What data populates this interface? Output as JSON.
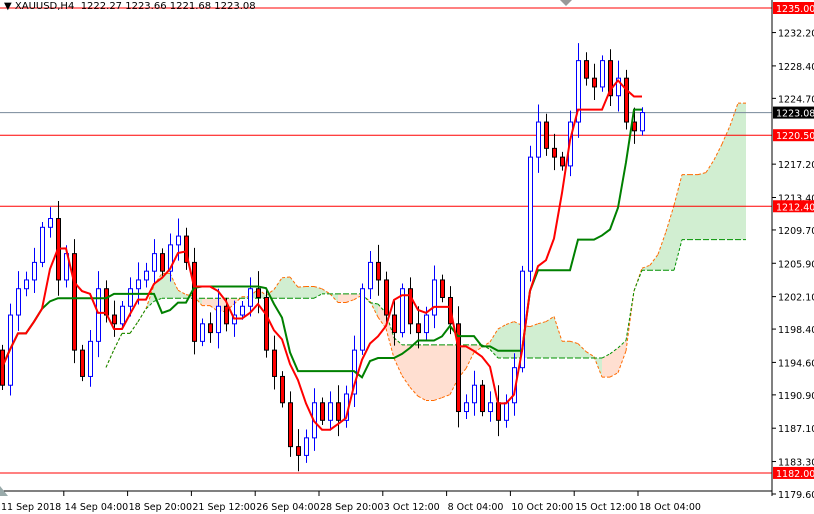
{
  "header": {
    "symbol": "XAUUSD,H4",
    "ohlc": "1222.27 1223.66 1221.68 1223.08"
  },
  "chart_data": {
    "type": "candlestick",
    "title": "XAUUSD,H4",
    "ylim": [
      1179.6,
      1235.0
    ],
    "y_ticks": [
      "1232.20",
      "1228.40",
      "1224.70",
      "1217.20",
      "1213.40",
      "1209.70",
      "1205.90",
      "1202.10",
      "1198.40",
      "1194.60",
      "1190.90",
      "1187.10",
      "1183.30",
      "1179.60"
    ],
    "x_ticks": [
      "11 Sep 2018",
      "14 Sep 04:00",
      "18 Sep 20:00",
      "21 Sep 12:00",
      "26 Sep 04:00",
      "28 Sep 20:00",
      "3 Oct 12:00",
      "8 Oct 04:00",
      "10 Oct 20:00",
      "15 Oct 12:00",
      "18 Oct 04:00"
    ],
    "closes": [
      1192,
      1200,
      1203,
      1204,
      1206,
      1210,
      1211,
      1204,
      1207,
      1196,
      1193,
      1197,
      1203,
      1200,
      1199,
      1201,
      1203,
      1204,
      1205,
      1207,
      1205,
      1208,
      1209,
      1206,
      1197,
      1199,
      1198,
      1201,
      1199,
      1200,
      1201,
      1203,
      1202,
      1196,
      1193,
      1190,
      1185,
      1184,
      1186,
      1190,
      1188,
      1190,
      1188,
      1191,
      1196,
      1203,
      1206,
      1204,
      1200,
      1198,
      1203,
      1199,
      1198,
      1200,
      1204,
      1202,
      1199,
      1189,
      1190,
      1192,
      1189,
      1190,
      1188,
      1190,
      1194,
      1205,
      1218,
      1222,
      1219,
      1218,
      1217,
      1222,
      1229,
      1227,
      1226,
      1229,
      1225,
      1227,
      1222,
      1221,
      1223.08
    ],
    "first_open": 1196,
    "ichimoku": {
      "tenkan": 5,
      "kijun": 13,
      "senkou_b": 26,
      "shift": 13,
      "tenkan_color": "#ff0000",
      "kijun_color": "#008000"
    },
    "levels": [
      {
        "label": "1235.00",
        "value": 1235.0,
        "color": "#ff0000"
      },
      {
        "label": "1220.50",
        "value": 1220.5,
        "color": "#ff0000"
      },
      {
        "label": "1212.40",
        "value": 1212.4,
        "color": "#ff0000"
      },
      {
        "label": "1182.00",
        "value": 1182.0,
        "color": "#ff0000"
      }
    ],
    "current_price": {
      "label": "1223.08",
      "value": 1223.08,
      "color": "#000000"
    },
    "colors": {
      "bull": "#0000ff",
      "bear_body": "#ff0000",
      "bear_outline": "#000000"
    }
  }
}
